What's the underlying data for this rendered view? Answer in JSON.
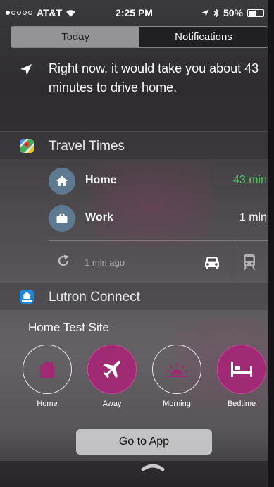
{
  "status_bar": {
    "carrier": "AT&T",
    "time": "2:25 PM",
    "battery": "50%",
    "battery_level": 0.5
  },
  "tabs": [
    {
      "label": "Today",
      "active": true
    },
    {
      "label": "Notifications",
      "active": false
    }
  ],
  "drive_time": {
    "message": "Right now, it would take you about 43 minutes to drive home."
  },
  "travel_times": {
    "title": "Travel Times",
    "places": [
      {
        "label": "Home",
        "time": "43 min",
        "icon": "house-icon",
        "time_color": "#4fc460"
      },
      {
        "label": "Work",
        "time": "1 min",
        "icon": "briefcase-icon",
        "time_color": "#ffffff"
      }
    ],
    "updated": "1 min ago"
  },
  "lutron": {
    "title": "Lutron Connect",
    "site": "Home Test Site",
    "scenes": [
      {
        "label": "Home",
        "icon": "house-icon",
        "active": false
      },
      {
        "label": "Away",
        "icon": "airplane-icon",
        "active": true
      },
      {
        "label": "Morning",
        "icon": "sunrise-icon",
        "active": false
      },
      {
        "label": "Bedtime",
        "icon": "bed-icon",
        "active": true
      }
    ],
    "go_button": "Go to App",
    "accent": "#a02a74"
  }
}
